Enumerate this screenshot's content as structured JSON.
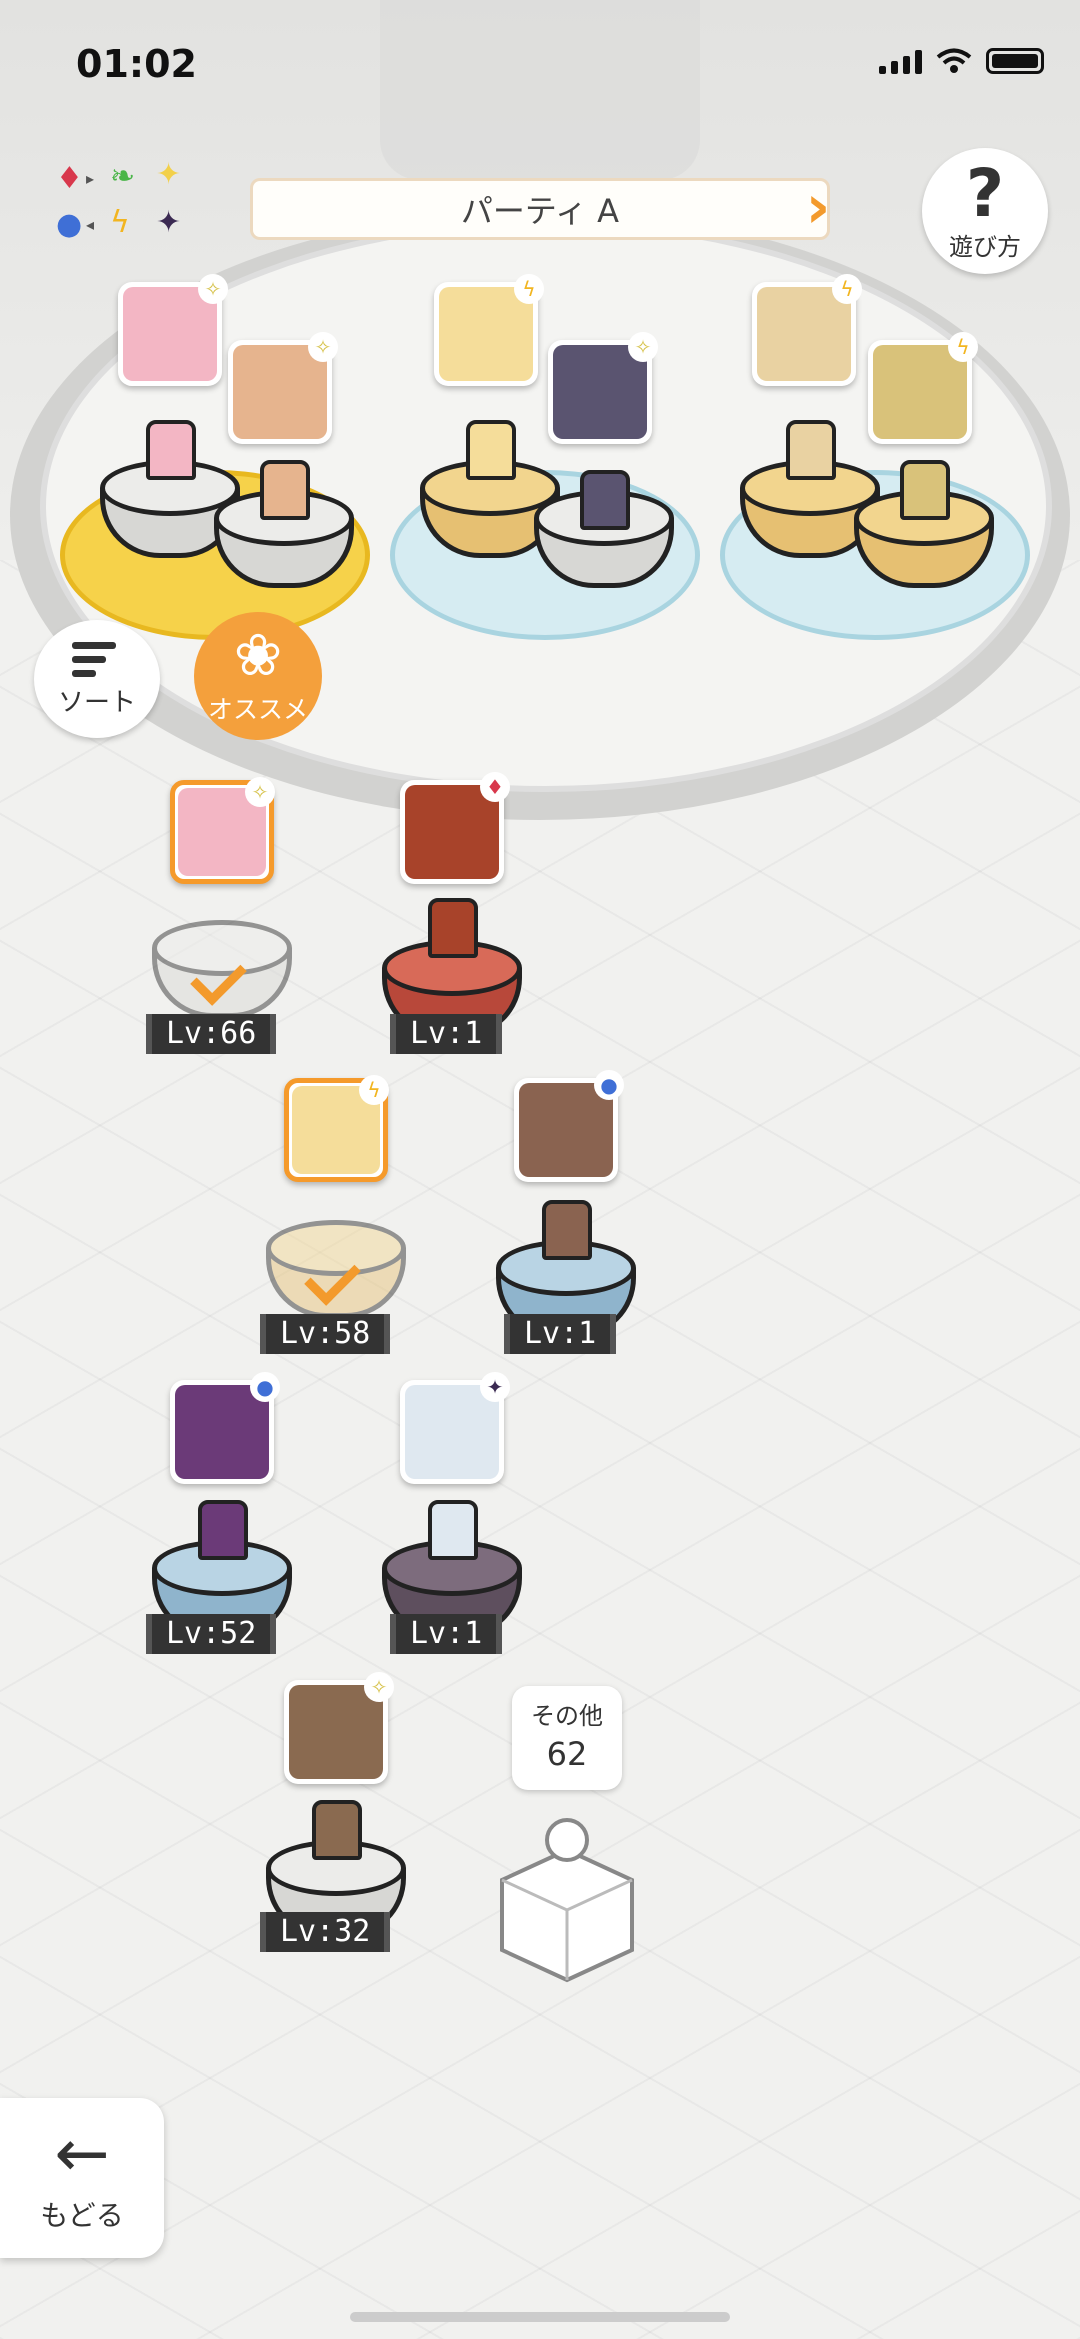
{
  "status_bar": {
    "time": "01:02"
  },
  "header": {
    "party_title": "パーティ A",
    "help_label": "遊び方",
    "help_glyph": "?"
  },
  "element_symbols": [
    "♦",
    "▸",
    "❧",
    "✦",
    "●",
    "◂",
    "ϟ",
    "✦"
  ],
  "buttons": {
    "sort_label": "ソート",
    "recommend_label": "オススメ",
    "back_label": "もどる",
    "back_glyph": "←"
  },
  "colors": {
    "accent": "#f39a2c",
    "level_bg": "#333333"
  },
  "party_members": [
    {
      "name": "pink-hair-girl",
      "element": "✧",
      "face": "#f3b6c4"
    },
    {
      "name": "brown-hair-girl",
      "element": "✧",
      "face": "#e6b48e"
    },
    {
      "name": "blonde-girl",
      "element": "ϟ",
      "face": "#f5dd9a"
    },
    {
      "name": "dark-hair-man",
      "element": "✧",
      "face": "#5a5470"
    },
    {
      "name": "glasses-woman",
      "element": "ϟ",
      "face": "#e9d2a2"
    },
    {
      "name": "golden-beast",
      "element": "ϟ",
      "face": "#d9c27a"
    }
  ],
  "roster": [
    {
      "level": "Lv:66",
      "element": "✧",
      "selected": true,
      "face": "#f3b6c4"
    },
    {
      "level": "Lv:1",
      "element": "♦",
      "selected": false,
      "face": "#a8432a"
    },
    {
      "level": "Lv:58",
      "element": "ϟ",
      "selected": true,
      "face": "#f5dd9a"
    },
    {
      "level": "Lv:1",
      "element": "●",
      "selected": false,
      "face": "#8a6350"
    },
    {
      "level": "Lv:52",
      "element": "●",
      "selected": false,
      "face": "#6b3a78"
    },
    {
      "level": "Lv:1",
      "element": "✦",
      "selected": false,
      "face": "#dfe8f0"
    },
    {
      "level": "Lv:32",
      "element": "✧",
      "selected": false,
      "face": "#8a6a50"
    }
  ],
  "others": {
    "label": "その他",
    "count": "62"
  }
}
